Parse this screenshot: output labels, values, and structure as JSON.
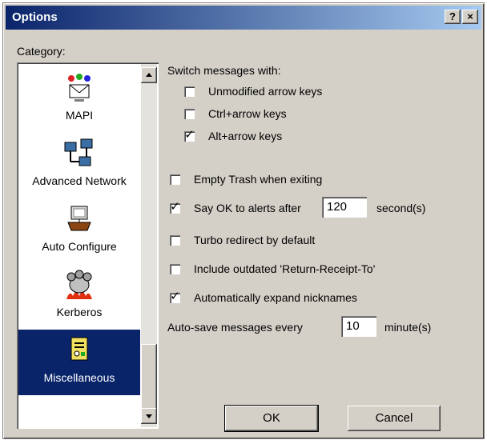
{
  "window": {
    "title": "Options",
    "help_label": "?",
    "close_label": "×"
  },
  "category": {
    "label": "Category:",
    "items": [
      {
        "label": "MAPI",
        "icon": "mapi-icon",
        "selected": false
      },
      {
        "label": "Advanced Network",
        "icon": "advanced-network-icon",
        "selected": false
      },
      {
        "label": "Auto Configure",
        "icon": "auto-configure-icon",
        "selected": false
      },
      {
        "label": "Kerberos",
        "icon": "kerberos-icon",
        "selected": false
      },
      {
        "label": "Miscellaneous",
        "icon": "miscellaneous-icon",
        "selected": true
      }
    ]
  },
  "switch_messages": {
    "label": "Switch messages with:",
    "options": [
      {
        "label": "Unmodified arrow keys",
        "checked": false
      },
      {
        "label": "Ctrl+arrow keys",
        "checked": false
      },
      {
        "label": "Alt+arrow keys",
        "checked": true
      }
    ]
  },
  "options": {
    "empty_trash": {
      "label": "Empty Trash when exiting",
      "checked": false
    },
    "say_ok": {
      "label": "Say OK to alerts after",
      "checked": true,
      "value": "120",
      "suffix": "second(s)"
    },
    "turbo_redirect": {
      "label": "Turbo redirect by default",
      "checked": false
    },
    "include_outdated": {
      "label": "Include outdated 'Return-Receipt-To'",
      "checked": false
    },
    "auto_expand": {
      "label": "Automatically expand nicknames",
      "checked": true
    },
    "auto_save": {
      "label": "Auto-save messages every",
      "value": "10",
      "suffix": "minute(s)"
    }
  },
  "buttons": {
    "ok": "OK",
    "cancel": "Cancel"
  },
  "colors": {
    "selection": "#0a246a",
    "face": "#d4d0c8"
  }
}
